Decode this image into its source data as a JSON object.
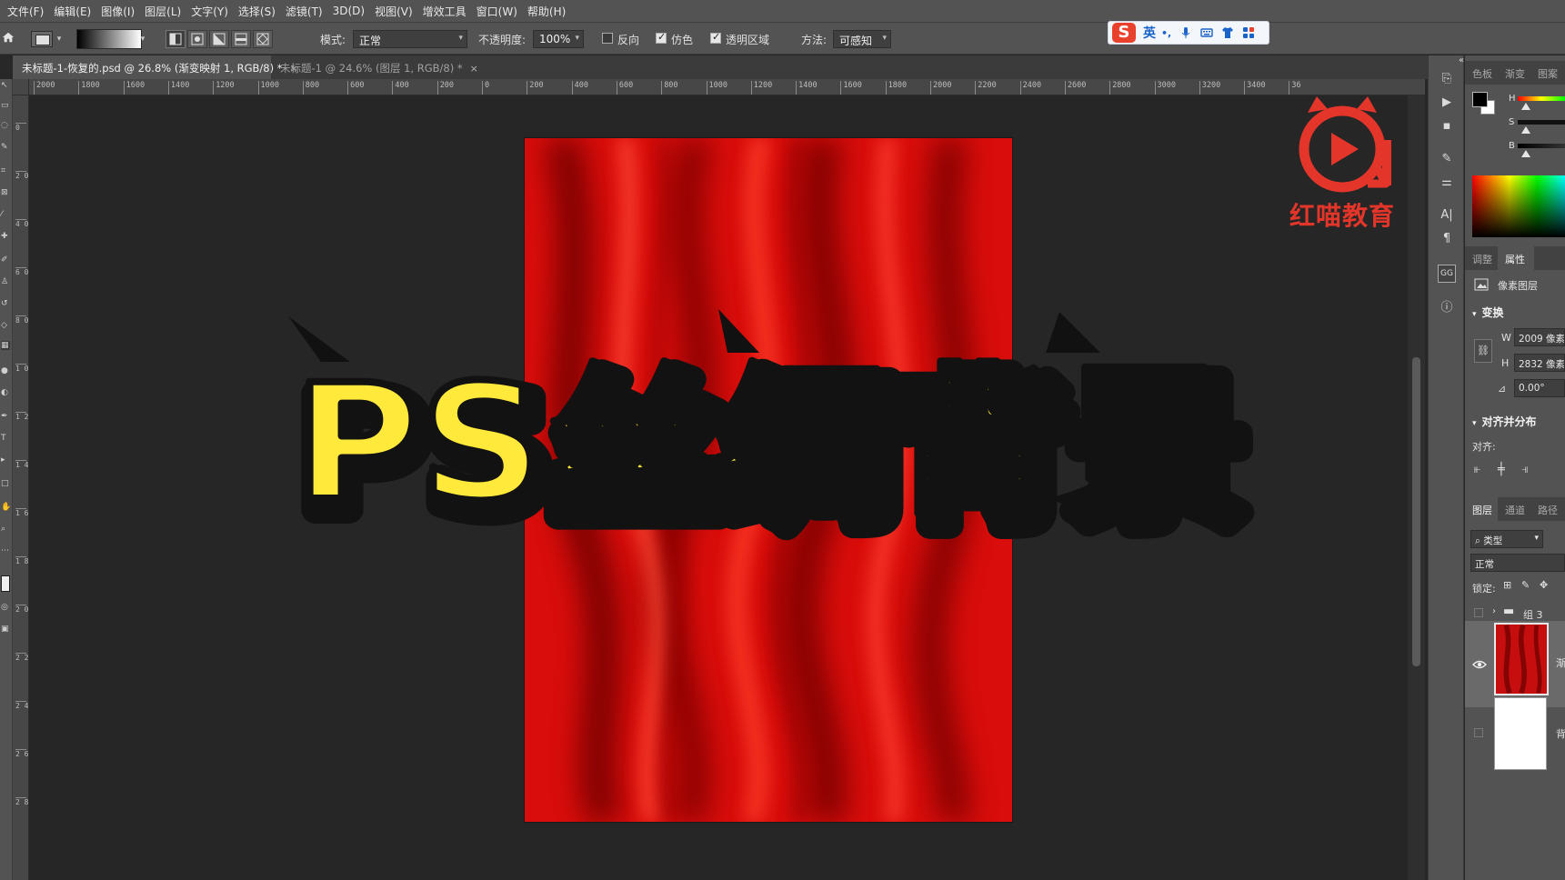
{
  "menubar": {
    "items": [
      "文件(F)",
      "编辑(E)",
      "图像(I)",
      "图层(L)",
      "文字(Y)",
      "选择(S)",
      "滤镜(T)",
      "3D(D)",
      "视图(V)",
      "增效工具",
      "窗口(W)",
      "帮助(H)"
    ]
  },
  "options": {
    "mode_label": "模式:",
    "mode_value": "正常",
    "opacity_label": "不透明度:",
    "opacity_value": "100%",
    "reverse_label": "反向",
    "dither_label": "仿色",
    "transparency_label": "透明区域",
    "method_label": "方法:",
    "method_value": "可感知",
    "reverse_checked": false,
    "dither_checked": true,
    "transparency_checked": true
  },
  "ime": {
    "lang": "英",
    "punct": "•,",
    "logo": "S"
  },
  "tabs": [
    {
      "label": "未标题-1-恢复的.psd @ 26.8% (渐变映射 1, RGB/8) *",
      "close": "×",
      "active": true
    },
    {
      "label": "未标题-1 @ 24.6% (图层 1, RGB/8) *",
      "close": "×",
      "active": false
    }
  ],
  "ruler_h": [
    "2000",
    "1800",
    "1600",
    "1400",
    "1200",
    "1000",
    "800",
    "600",
    "400",
    "200",
    "0",
    "200",
    "400",
    "600",
    "800",
    "1000",
    "1200",
    "1400",
    "1600",
    "1800",
    "2000",
    "2200",
    "2400",
    "2600",
    "2800",
    "3000",
    "3200",
    "3400",
    "36"
  ],
  "ruler_v": [
    "0",
    "2 0 0",
    "4 0 0",
    "6 0 0",
    "8 0 0",
    "1 0 0 0",
    "1 2 0 0",
    "1 4 0 0",
    "1 6 0 0",
    "1 8 0 0",
    "2 0 0 0",
    "2 2 0 0",
    "2 4 0 0",
    "2 6 0 0",
    "2 8 0 0"
  ],
  "overlay": {
    "title": "PS丝绸背景"
  },
  "brand": {
    "name": "红喵教育"
  },
  "color_panel": {
    "tabs": [
      "色板",
      "渐变",
      "图案"
    ],
    "h_label": "H",
    "s_label": "S",
    "b_label": "B"
  },
  "properties": {
    "tabs": [
      "调整",
      "属性"
    ],
    "layer_type": "像素图层",
    "transform_title": "变换",
    "w_label": "W",
    "w_value": "2009 像素",
    "h_label": "H",
    "h_value": "2832 像素",
    "angle_value": "0.00°",
    "align_title": "对齐并分布",
    "align_label": "对齐:"
  },
  "layers": {
    "tabs": [
      "图层",
      "通道",
      "路径"
    ],
    "filter_label": "类型",
    "blend_mode": "正常",
    "lock_label": "锁定:",
    "group_name": "组 3",
    "layer1_name": "渐",
    "layer2_name": "背"
  },
  "colors": {
    "silk": "#d80d0c",
    "title_fill": "#ffe93a",
    "brand_red": "#e3352a"
  }
}
